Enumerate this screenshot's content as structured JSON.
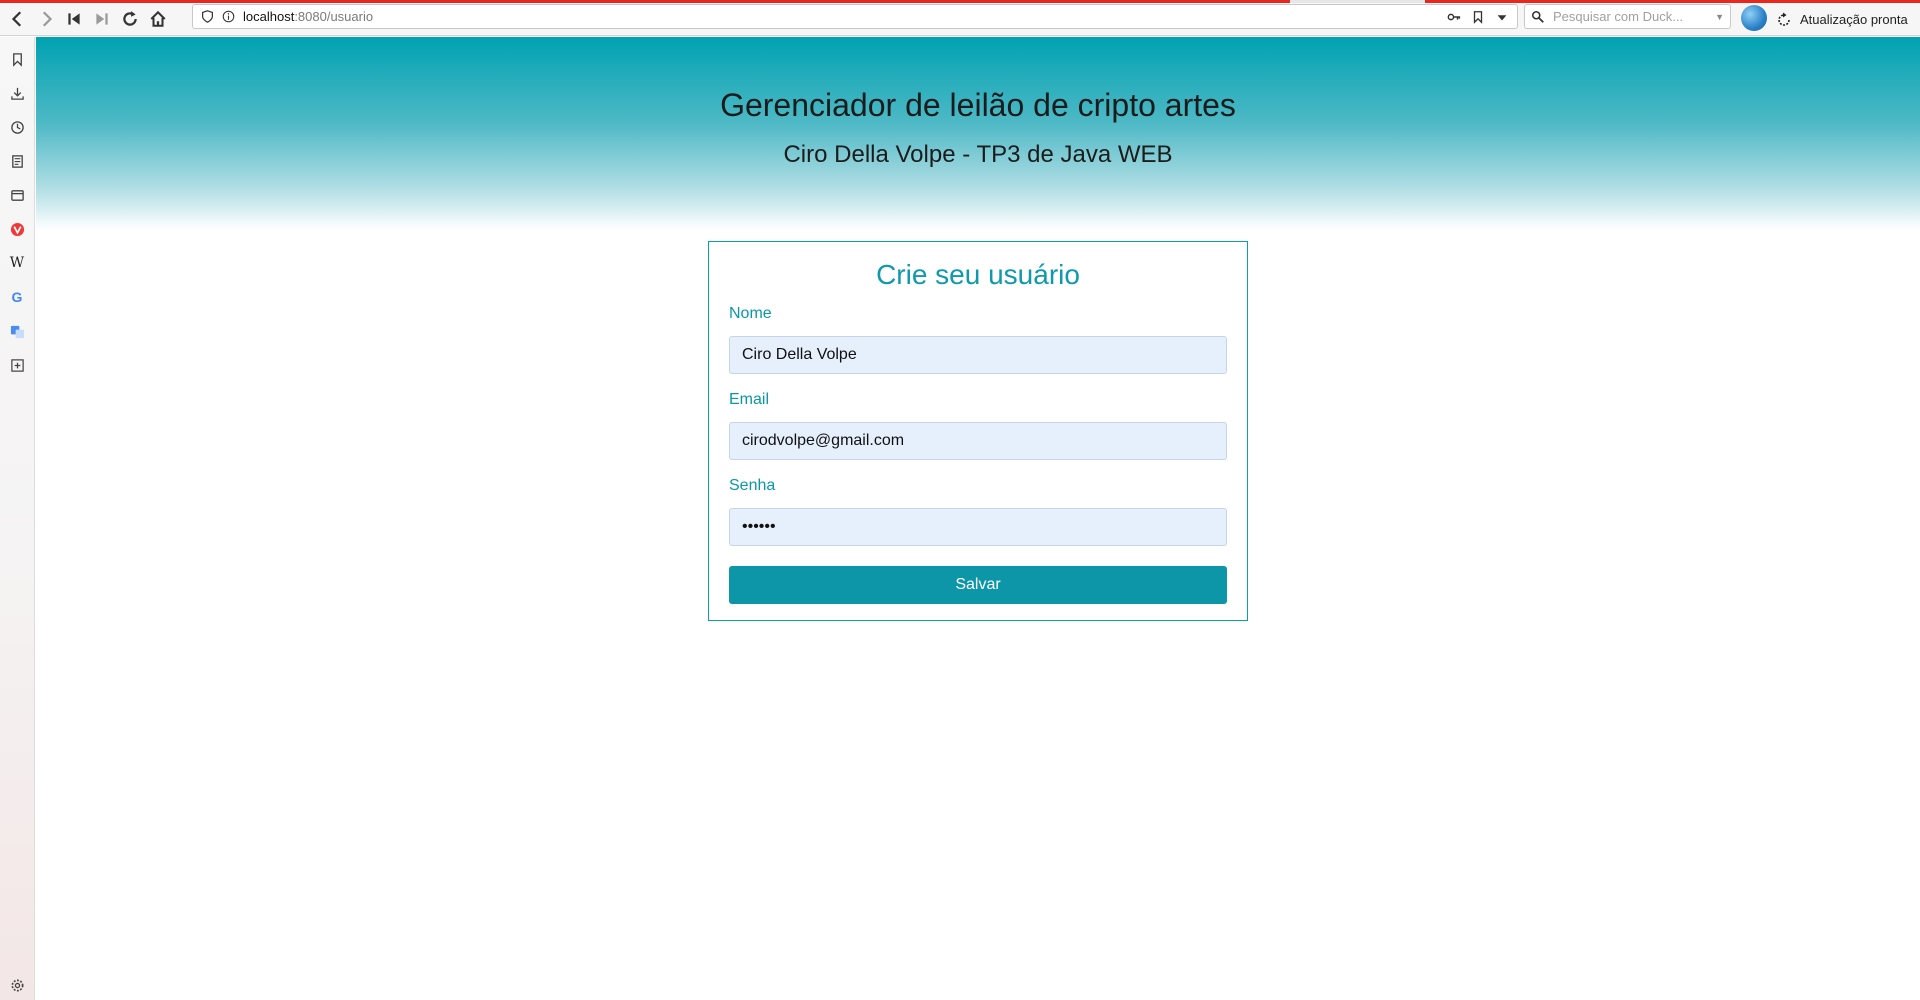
{
  "browser": {
    "url_host": "localhost",
    "url_path": ":8080/usuario",
    "search_placeholder": "Pesquisar com Duck...",
    "update_status": "Atualização pronta"
  },
  "header": {
    "title": "Gerenciador de leilão de cripto artes",
    "subtitle": "Ciro Della Volpe - TP3 de Java WEB"
  },
  "form": {
    "title": "Crie seu usuário",
    "name_label": "Nome",
    "name_value": "Ciro Della Volpe",
    "email_label": "Email",
    "email_value": "cirodvolpe@gmail.com",
    "password_label": "Senha",
    "password_value": "123456",
    "submit_label": "Salvar"
  },
  "colors": {
    "accent": "#0c96a8",
    "header_top": "#00a2b2",
    "input_bg": "#e6f0fd"
  }
}
